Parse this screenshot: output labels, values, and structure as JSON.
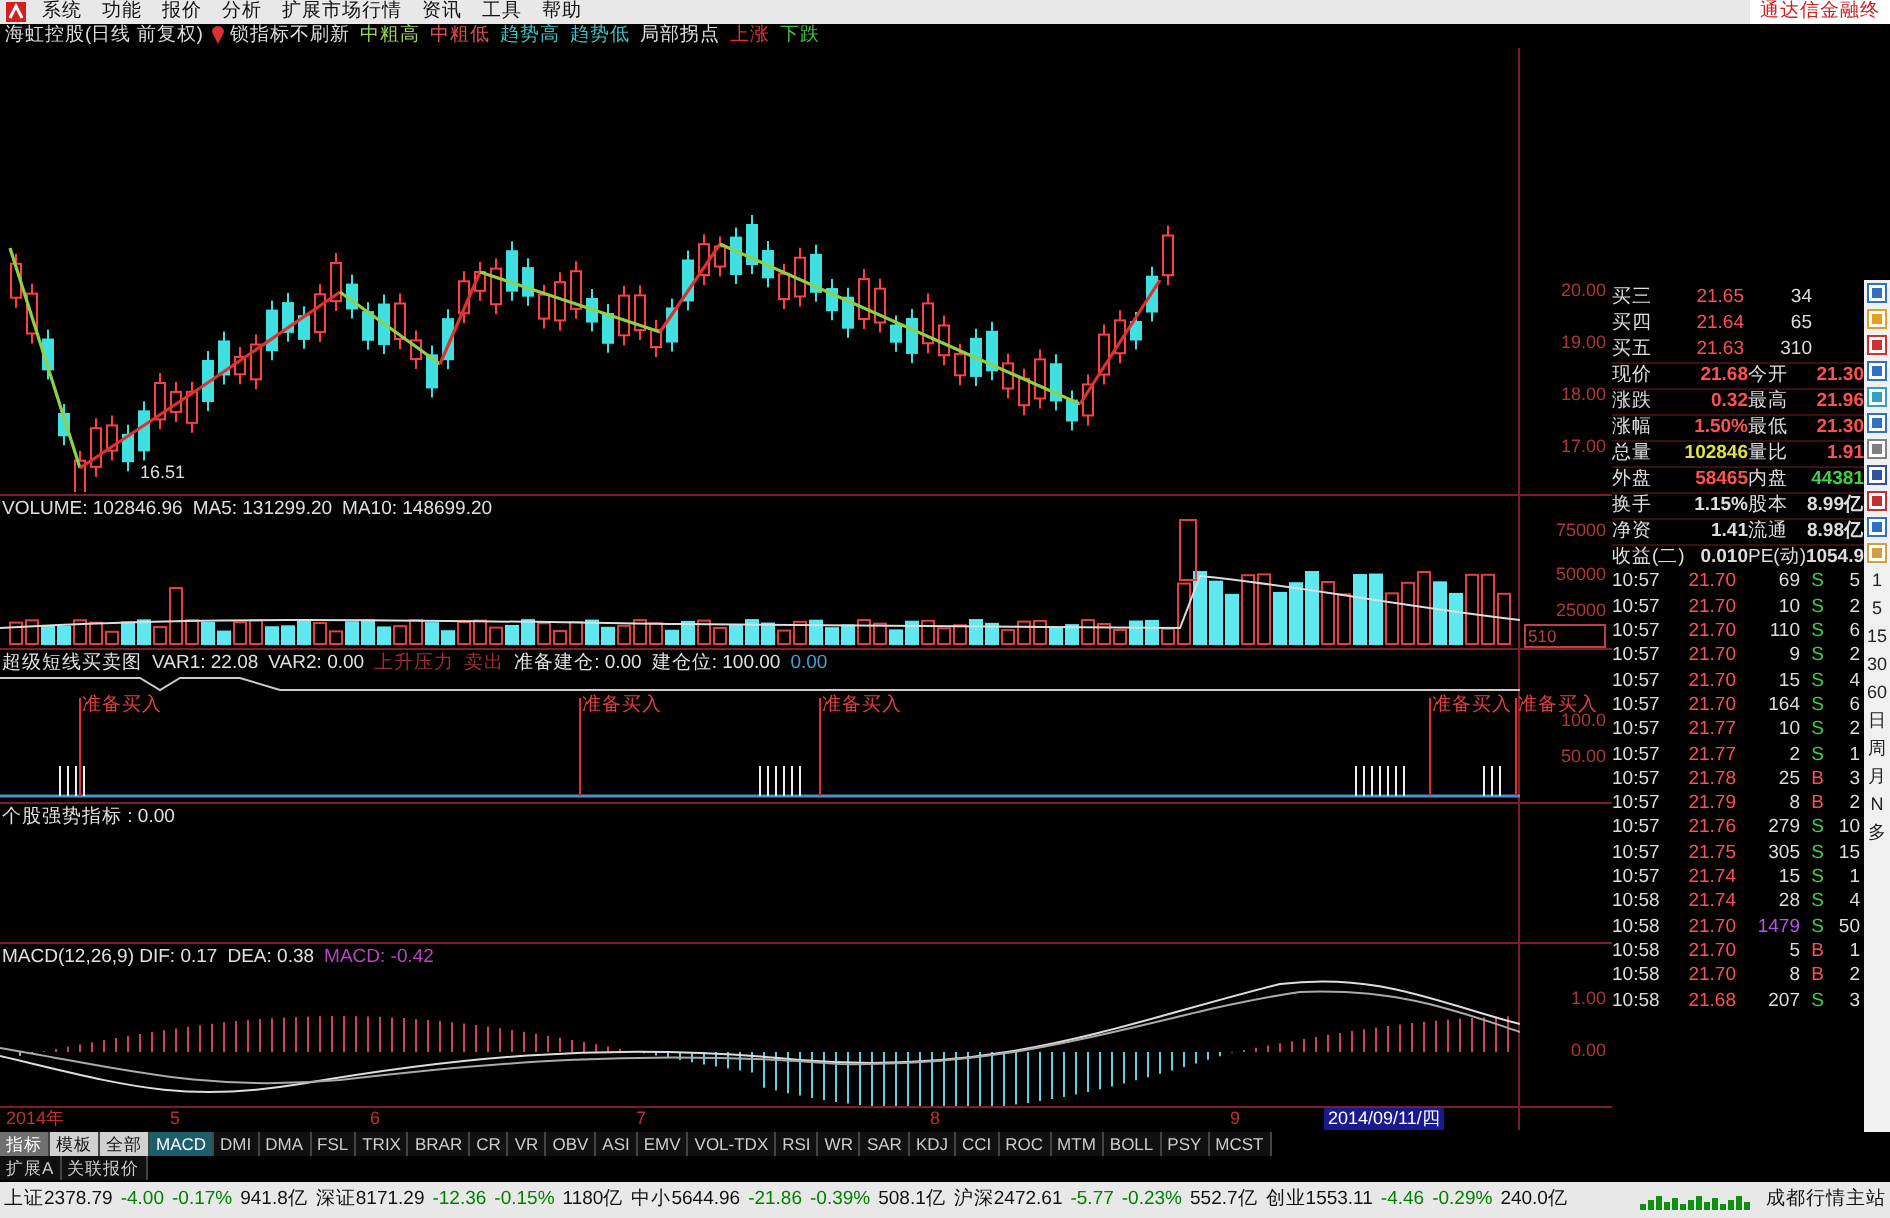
{
  "menu_bar": {
    "items": [
      "系统",
      "功能",
      "报价",
      "分析",
      "扩展市场行情",
      "资讯",
      "工具",
      "帮助"
    ],
    "ad_text": "通达信金融终"
  },
  "chart_header": {
    "title": "海虹控股(日线 前复权)",
    "lock_label": "锁指标不刷新",
    "legend": [
      {
        "text": "中粗高",
        "color": "#9fd35a"
      },
      {
        "text": "中粗低",
        "color": "#e05050"
      },
      {
        "text": "趋势高",
        "color": "#40c0c0"
      },
      {
        "text": "趋势低",
        "color": "#40c0c0"
      },
      {
        "text": "局部拐点",
        "color": "#e0e0e0"
      },
      {
        "text": "上涨",
        "color": "#e03030"
      },
      {
        "text": "下跌",
        "color": "#40c040"
      }
    ]
  },
  "price_pane": {
    "low_label": "16.51",
    "axis": [
      "20.00",
      "19.00",
      "18.00",
      "17.00"
    ]
  },
  "volume_pane": {
    "legend": [
      {
        "text": "VOLUME: 102846.96",
        "color": "#e0e0e0"
      },
      {
        "text": "MA5: 131299.20",
        "color": "#e0e0e0"
      },
      {
        "text": "MA10: 148699.20",
        "color": "#e0e0e0"
      }
    ],
    "axis": [
      "75000",
      "50000",
      "25000"
    ],
    "cursor_label": "510"
  },
  "signal_pane": {
    "legend": [
      {
        "text": "超级短线买卖图",
        "color": "#e0e0e0"
      },
      {
        "text": "VAR1: 22.08",
        "color": "#e0e0e0"
      },
      {
        "text": "VAR2: 0.00",
        "color": "#e0e0e0"
      },
      {
        "text": "上升压力",
        "color": "#a03030"
      },
      {
        "text": "卖出",
        "color": "#a03030"
      },
      {
        "text": "准备建仓: 0.00",
        "color": "#e0e0e0"
      },
      {
        "text": "建仓位: 100.00",
        "color": "#e0e0e0"
      },
      {
        "text": "0.00",
        "color": "#40a0d0"
      }
    ],
    "axis": [
      "100.0",
      "50.00"
    ],
    "signals": [
      "准备买入",
      "准备买入",
      "准备买入",
      "准备买入",
      "准备买入"
    ]
  },
  "strength_pane": {
    "legend": [
      {
        "text": "个股强势指标 : 0.00",
        "color": "#e0e0e0"
      }
    ]
  },
  "macd_pane": {
    "legend": [
      {
        "text": "MACD(12,26,9) DIF: 0.17",
        "color": "#e0e0e0"
      },
      {
        "text": "DEA: 0.38",
        "color": "#e0e0e0"
      },
      {
        "text": "MACD: -0.42",
        "color": "#c040c0"
      }
    ],
    "axis": [
      "1.00",
      "0.00"
    ]
  },
  "date_axis": {
    "labels": [
      "2014年",
      "5",
      "6",
      "7",
      "8",
      "9"
    ],
    "cursor": "2014/09/11/四"
  },
  "order_book": [
    {
      "label": "买三",
      "price": "21.65",
      "volume": "34"
    },
    {
      "label": "买四",
      "price": "21.64",
      "volume": "65"
    },
    {
      "label": "买五",
      "price": "21.63",
      "volume": "310"
    }
  ],
  "stats": [
    {
      "cells": [
        {
          "label": "现价",
          "value": "21.68",
          "kind": "up"
        },
        {
          "label": "今开",
          "value": "21.30",
          "kind": "up"
        }
      ]
    },
    {
      "cells": [
        {
          "label": "涨跌",
          "value": "0.32",
          "kind": "up"
        },
        {
          "label": "最高",
          "value": "21.96",
          "kind": "up"
        }
      ]
    },
    {
      "cells": [
        {
          "label": "涨幅",
          "value": "1.50%",
          "kind": "up"
        },
        {
          "label": "最低",
          "value": "21.30",
          "kind": "up"
        }
      ]
    },
    {
      "cells": [
        {
          "label": "总量",
          "value": "102846",
          "kind": "volume"
        },
        {
          "label": "量比",
          "value": "1.91",
          "kind": "up"
        }
      ]
    },
    {
      "cells": [
        {
          "label": "外盘",
          "value": "58465",
          "kind": "up"
        },
        {
          "label": "内盘",
          "value": "44381",
          "kind": "down"
        }
      ]
    },
    {
      "cells": [
        {
          "label": "换手",
          "value": "1.15%",
          "kind": "neutral"
        },
        {
          "label": "股本",
          "value": "8.99亿",
          "kind": "neutral"
        }
      ]
    },
    {
      "cells": [
        {
          "label": "净资",
          "value": "1.41",
          "kind": "neutral"
        },
        {
          "label": "流通",
          "value": "8.98亿",
          "kind": "neutral"
        }
      ]
    },
    {
      "cells": [
        {
          "label": "收益(二)",
          "value": "0.010",
          "kind": "neutral"
        },
        {
          "label": "PE(动)",
          "value": "1054.9",
          "kind": "neutral"
        }
      ]
    }
  ],
  "ticks": [
    {
      "time": "10:57",
      "price": "21.70",
      "volume": "69",
      "side": "S",
      "buy": false,
      "large": false,
      "count": "5"
    },
    {
      "time": "10:57",
      "price": "21.70",
      "volume": "10",
      "side": "S",
      "buy": false,
      "large": false,
      "count": "2"
    },
    {
      "time": "10:57",
      "price": "21.70",
      "volume": "110",
      "side": "S",
      "buy": false,
      "large": false,
      "count": "6"
    },
    {
      "time": "10:57",
      "price": "21.70",
      "volume": "9",
      "side": "S",
      "buy": false,
      "large": false,
      "count": "2"
    },
    {
      "time": "10:57",
      "price": "21.70",
      "volume": "15",
      "side": "S",
      "buy": false,
      "large": false,
      "count": "4"
    },
    {
      "time": "10:57",
      "price": "21.70",
      "volume": "164",
      "side": "S",
      "buy": false,
      "large": false,
      "count": "6"
    },
    {
      "time": "10:57",
      "price": "21.77",
      "volume": "10",
      "side": "S",
      "buy": false,
      "large": false,
      "count": "2"
    },
    {
      "time": "10:57",
      "price": "21.77",
      "volume": "2",
      "side": "S",
      "buy": false,
      "large": false,
      "count": "1"
    },
    {
      "time": "10:57",
      "price": "21.78",
      "volume": "25",
      "side": "B",
      "buy": true,
      "large": false,
      "count": "3"
    },
    {
      "time": "10:57",
      "price": "21.79",
      "volume": "8",
      "side": "B",
      "buy": true,
      "large": false,
      "count": "2"
    },
    {
      "time": "10:57",
      "price": "21.76",
      "volume": "279",
      "side": "S",
      "buy": false,
      "large": false,
      "count": "10"
    },
    {
      "time": "10:57",
      "price": "21.75",
      "volume": "305",
      "side": "S",
      "buy": false,
      "large": false,
      "count": "15"
    },
    {
      "time": "10:57",
      "price": "21.74",
      "volume": "15",
      "side": "S",
      "buy": false,
      "large": false,
      "count": "1"
    },
    {
      "time": "10:58",
      "price": "21.74",
      "volume": "28",
      "side": "S",
      "buy": false,
      "large": false,
      "count": "4"
    },
    {
      "time": "10:58",
      "price": "21.70",
      "volume": "1479",
      "side": "S",
      "buy": false,
      "large": true,
      "count": "50"
    },
    {
      "time": "10:58",
      "price": "21.70",
      "volume": "5",
      "side": "B",
      "buy": true,
      "large": false,
      "count": "1"
    },
    {
      "time": "10:58",
      "price": "21.70",
      "volume": "8",
      "side": "B",
      "buy": true,
      "large": false,
      "count": "2"
    },
    {
      "time": "10:58",
      "price": "21.68",
      "volume": "207",
      "side": "S",
      "buy": false,
      "large": false,
      "count": "3"
    }
  ],
  "period_buttons": [
    "1",
    "5",
    "15",
    "30",
    "60",
    "日",
    "周",
    "月",
    "N",
    "多"
  ],
  "mode_tabs": [
    {
      "label": "指标",
      "selected": true
    },
    {
      "label": "模板",
      "selected": false
    },
    {
      "label": "全部",
      "selected": false
    }
  ],
  "indicator_tabs": [
    {
      "label": "MACD",
      "selected": true
    },
    {
      "label": "DMI",
      "selected": false
    },
    {
      "label": "DMA",
      "selected": false
    },
    {
      "label": "FSL",
      "selected": false
    },
    {
      "label": "TRIX",
      "selected": false
    },
    {
      "label": "BRAR",
      "selected": false
    },
    {
      "label": "CR",
      "selected": false
    },
    {
      "label": "VR",
      "selected": false
    },
    {
      "label": "OBV",
      "selected": false
    },
    {
      "label": "ASI",
      "selected": false
    },
    {
      "label": "EMV",
      "selected": false
    },
    {
      "label": "VOL-TDX",
      "selected": false
    },
    {
      "label": "RSI",
      "selected": false
    },
    {
      "label": "WR",
      "selected": false
    },
    {
      "label": "SAR",
      "selected": false
    },
    {
      "label": "KDJ",
      "selected": false
    },
    {
      "label": "CCI",
      "selected": false
    },
    {
      "label": "ROC",
      "selected": false
    },
    {
      "label": "MTM",
      "selected": false
    },
    {
      "label": "BOLL",
      "selected": false
    },
    {
      "label": "PSY",
      "selected": false
    },
    {
      "label": "MCST",
      "selected": false
    }
  ],
  "extension_tabs": [
    {
      "label": "扩展A",
      "selected": false
    },
    {
      "label": "关联报价",
      "selected": false
    }
  ],
  "status_bar": {
    "indices": [
      {
        "name": "上证2378.79",
        "change": "-4.00",
        "pct": "-0.17%",
        "amount": "941.8亿",
        "color": "#008000"
      },
      {
        "name": "深证8171.29",
        "change": "-12.36",
        "pct": "-0.15%",
        "amount": "1180亿",
        "color": "#008000"
      },
      {
        "name": "中小5644.96",
        "change": "-21.86",
        "pct": "-0.39%",
        "amount": "508.1亿",
        "color": "#008000"
      },
      {
        "name": "沪深2472.61",
        "change": "-5.77",
        "pct": "-0.23%",
        "amount": "552.7亿",
        "color": "#008000"
      },
      {
        "name": "创业1553.11",
        "change": "-4.46",
        "pct": "-0.29%",
        "amount": "240.0亿",
        "color": "#008000"
      }
    ],
    "server": "成都行情主站"
  }
}
